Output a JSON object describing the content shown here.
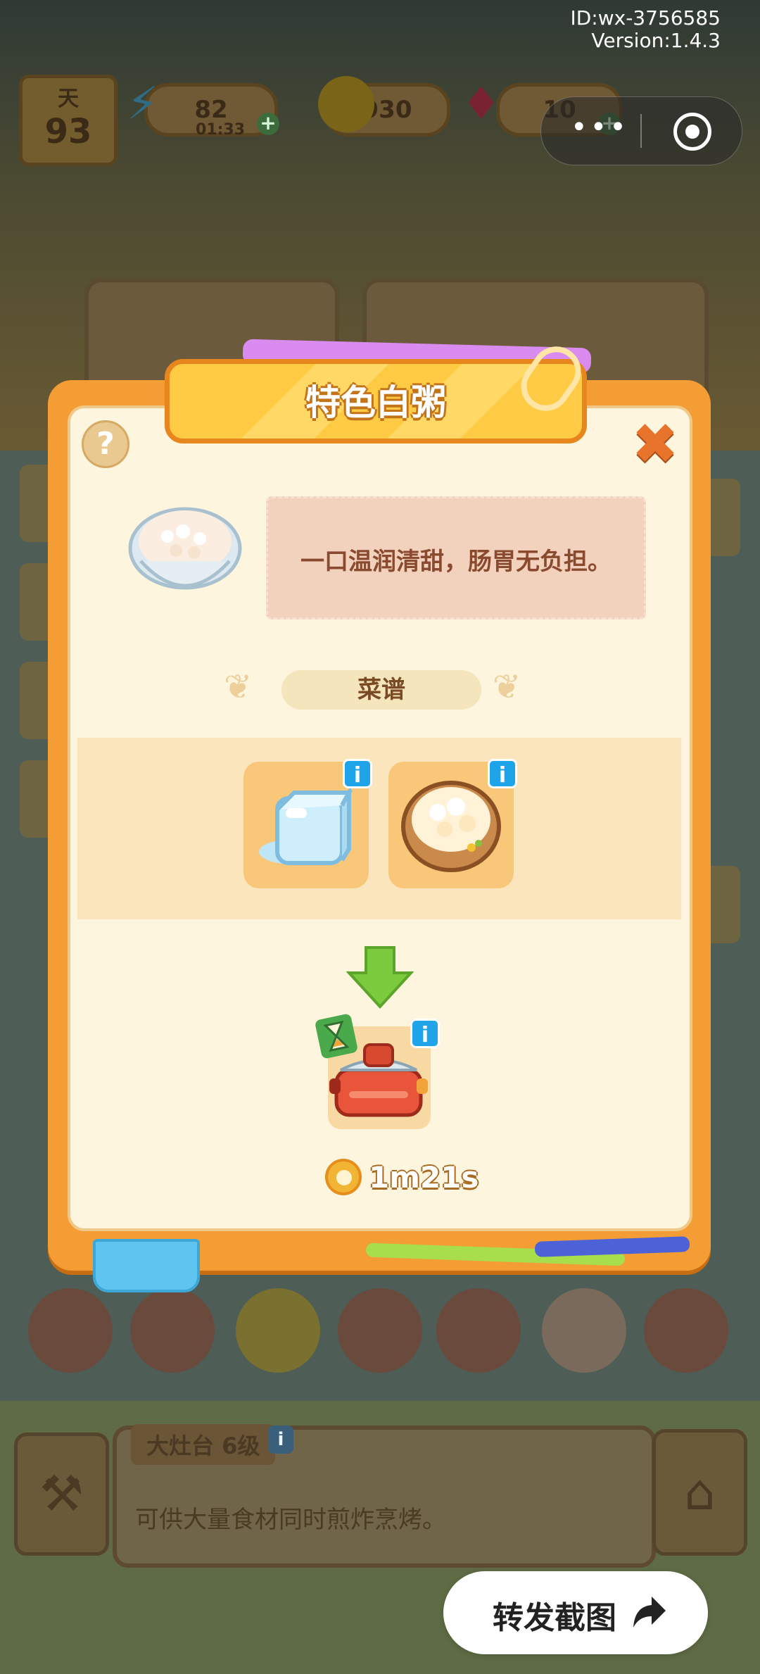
{
  "meta": {
    "id_label": "ID:wx-3756585",
    "version_label": "Version:1.4.3"
  },
  "hud": {
    "day_label": "天",
    "day_value": "93",
    "energy_value": "82",
    "energy_timer": "01:33",
    "coins_value": "930",
    "gems_value": "10",
    "plus_symbol": "+"
  },
  "modal": {
    "title": "特色白粥",
    "help_symbol": "?",
    "close_symbol": "✖",
    "description": "一口温润清甜，肠胃无负担。",
    "recipe_label": "菜谱",
    "info_symbol": "i",
    "ingredients": [
      {
        "name": "ice-cube"
      },
      {
        "name": "rice-bowl"
      }
    ],
    "cook_time": "1m21s"
  },
  "station": {
    "title": "大灶台 6级",
    "description": "可供大量食材同时煎炸烹烤。"
  },
  "share": {
    "label": "转发截图"
  },
  "colors": {
    "modal_orange": "#f39d34",
    "modal_cream": "#fdf5de",
    "title_yellow": "#ffcb45",
    "info_blue": "#1fa4ea",
    "arrow_green": "#7ccb3e"
  }
}
